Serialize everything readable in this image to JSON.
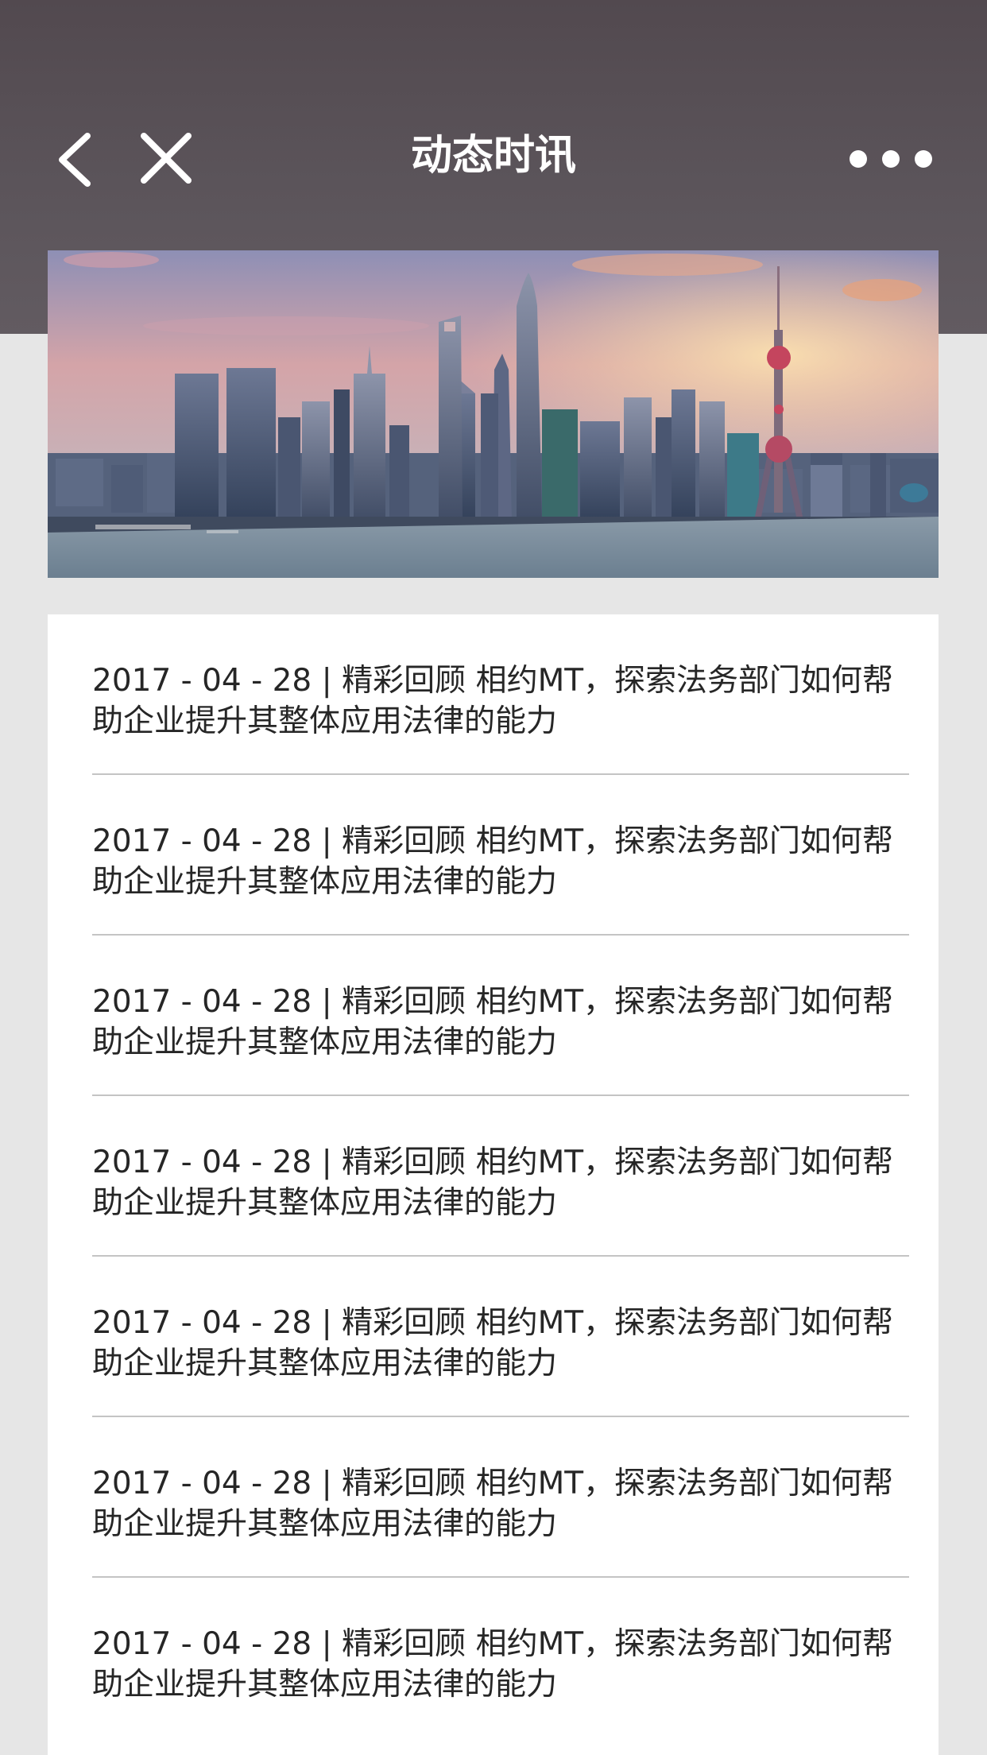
{
  "nav": {
    "title": "动态时讯",
    "back_icon": "chevron-left-icon",
    "close_icon": "close-icon",
    "more_icon": "more-horizontal-icon"
  },
  "banner": {
    "description_icon": "city-skyline-image"
  },
  "news": {
    "items": [
      {
        "text": "2017 - 04 - 28 | 精彩回顾 相约MT，探索法务部门如何帮助企业提升其整体应用法律的能力"
      },
      {
        "text": "2017 - 04 - 28 | 精彩回顾 相约MT，探索法务部门如何帮助企业提升其整体应用法律的能力"
      },
      {
        "text": "2017 - 04 - 28 | 精彩回顾 相约MT，探索法务部门如何帮助企业提升其整体应用法律的能力"
      },
      {
        "text": "2017 - 04 - 28 | 精彩回顾 相约MT，探索法务部门如何帮助企业提升其整体应用法律的能力"
      },
      {
        "text": "2017 - 04 - 28 | 精彩回顾 相约MT，探索法务部门如何帮助企业提升其整体应用法律的能力"
      },
      {
        "text": "2017 - 04 - 28 | 精彩回顾 相约MT，探索法务部门如何帮助企业提升其整体应用法律的能力"
      },
      {
        "text": "2017 - 04 - 28 | 精彩回顾 相约MT，探索法务部门如何帮助企业提升其整体应用法律的能力"
      }
    ]
  },
  "colors": {
    "header_bg": "#5b545a",
    "page_bg": "#e6e6e6",
    "card_bg": "#ffffff",
    "text": "#262626",
    "divider": "#c4c4c4"
  }
}
